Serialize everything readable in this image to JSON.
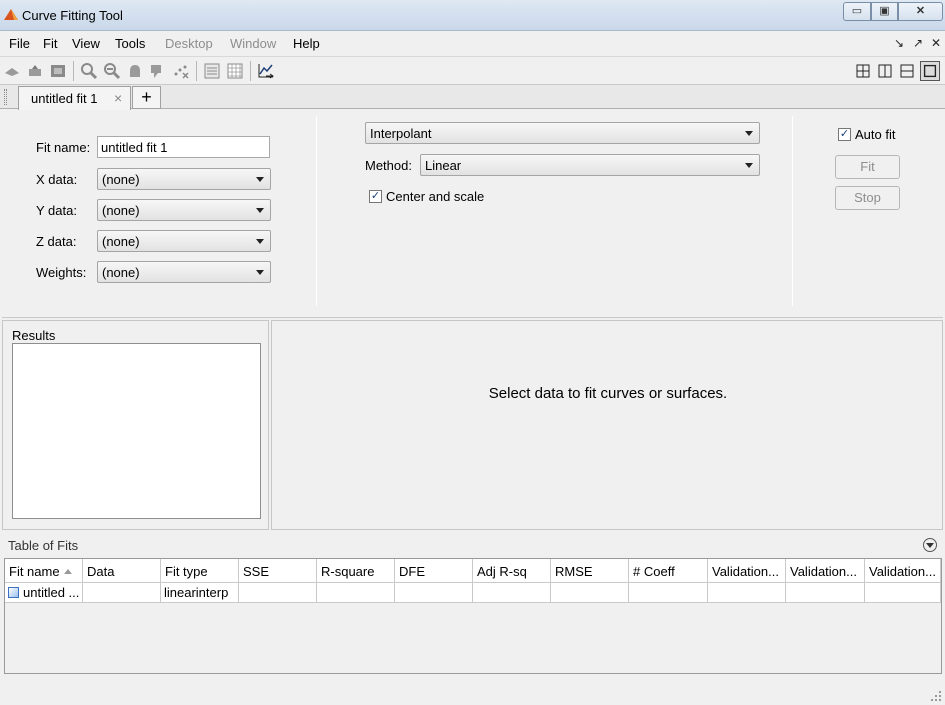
{
  "window": {
    "title": "Curve Fitting Tool",
    "min_glyph": "▭",
    "max_glyph": "▣",
    "close_glyph": "✕"
  },
  "menu": {
    "items": [
      "File",
      "Fit",
      "View",
      "Tools",
      "Desktop",
      "Window",
      "Help"
    ],
    "disabled": [
      "Desktop",
      "Window"
    ],
    "right_controls": [
      "↘",
      "↗",
      "✕"
    ]
  },
  "toolbar": {
    "icons": [
      "rotate-icon",
      "pan-3d-icon",
      "data-cursor-icon",
      "zoom-in-icon",
      "zoom-out-icon",
      "pan-icon",
      "data-tip-icon",
      "exclude-outliers-icon",
      "legend-icon",
      "grid-icon",
      "residuals-plot-icon"
    ],
    "layouts": [
      "layout-grid-icon",
      "layout-columns-icon",
      "layout-rows-icon",
      "layout-single-icon"
    ]
  },
  "tabs": {
    "active_label": "untitled fit 1",
    "close_glyph": "×",
    "add_glyph": "+"
  },
  "fit_form": {
    "fit_name_label": "Fit name:",
    "fit_name_value": "untitled fit 1",
    "x_label": "X data:",
    "x_value": "(none)",
    "y_label": "Y data:",
    "y_value": "(none)",
    "z_label": "Z data:",
    "z_value": "(none)",
    "weights_label": "Weights:",
    "weights_value": "(none)"
  },
  "fit_options": {
    "fit_type": "Interpolant",
    "method_label": "Method:",
    "method_value": "Linear",
    "center_scale_label": "Center and scale",
    "center_scale_checked": true
  },
  "fit_controls": {
    "auto_fit_label": "Auto fit",
    "auto_fit_checked": true,
    "fit_button": "Fit",
    "stop_button": "Stop"
  },
  "results": {
    "title": "Results"
  },
  "plot": {
    "message": "Select data to fit curves or surfaces."
  },
  "table_of_fits": {
    "title": "Table of Fits",
    "columns": [
      "Fit name",
      "Data",
      "Fit type",
      "SSE",
      "R-square",
      "DFE",
      "Adj R-sq",
      "RMSE",
      "# Coeff",
      "Validation...",
      "Validation...",
      "Validation..."
    ],
    "rows": [
      [
        "untitled ...",
        "",
        "linearinterp",
        "",
        "",
        "",
        "",
        "",
        "",
        "",
        "",
        ""
      ]
    ]
  },
  "colors": {
    "titlebar": "#c9d8ea",
    "panel": "#f0f0f0",
    "disabled_text": "#8d8d8d",
    "check": "#1c3f7a"
  }
}
